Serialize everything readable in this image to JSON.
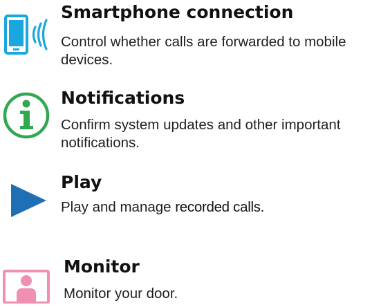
{
  "items": [
    {
      "id": "smartphone",
      "icon": "smartphone-signal-icon",
      "title": "Smartphone connection",
      "description": "Control whether calls are forwarded to mobile devices."
    },
    {
      "id": "notifications",
      "icon": "info-circle-icon",
      "title": "Notifications",
      "description": "Confirm system updates and other important notifications."
    },
    {
      "id": "play",
      "icon": "play-triangle-icon",
      "title": "Play",
      "description_prefix": "Play and manage ",
      "description_highlight": "recorded calls."
    },
    {
      "id": "monitor",
      "icon": "person-monitor-icon",
      "title": "Monitor",
      "description": "Monitor your door."
    }
  ],
  "colors": {
    "smartphone_blue": "#1aa7e0",
    "info_green": "#2fa84f",
    "play_blue": "#1f6fb5",
    "monitor_pink": "#ef8fb4"
  }
}
